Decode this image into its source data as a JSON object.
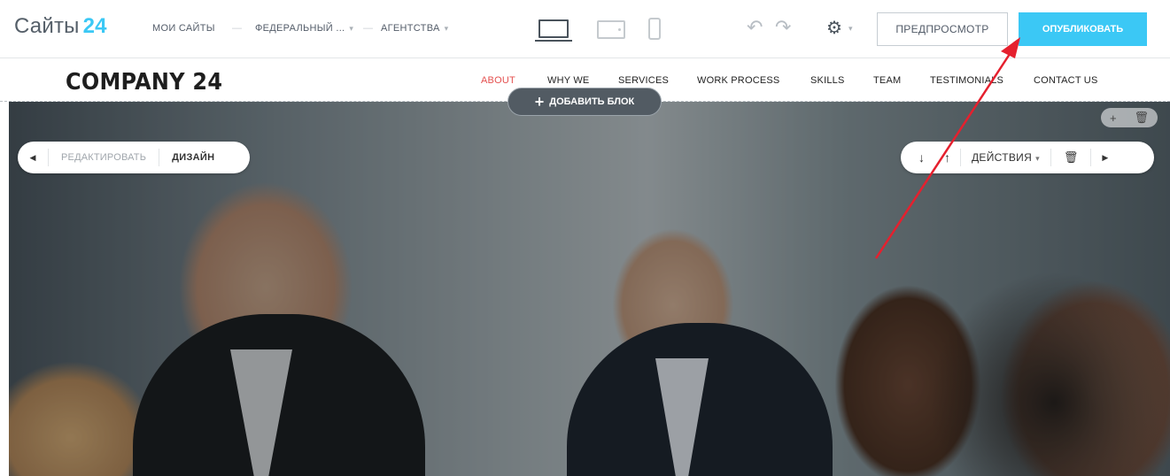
{
  "topbar": {
    "brand_name": "Сайты",
    "brand_number": "24",
    "nav": [
      {
        "label": "МОИ САЙТЫ"
      },
      {
        "label": "ФЕДЕРАЛЬНЫЙ ..."
      },
      {
        "label": "АГЕНТСТВА"
      }
    ],
    "undo_icon": "undo-icon",
    "redo_icon": "redo-icon",
    "settings_icon": "gear-icon",
    "preview_label": "ПРЕДПРОСМОТР",
    "publish_label": "ОПУБЛИКОВАТЬ",
    "accent_color": "#3bc8f5"
  },
  "site": {
    "logo": "COMPANY 24",
    "menu": [
      {
        "label": "ABOUT",
        "active": true
      },
      {
        "label": "WHY WE"
      },
      {
        "label": "SERVICES"
      },
      {
        "label": "WORK PROCESS"
      },
      {
        "label": "SKILLS"
      },
      {
        "label": "TEAM"
      },
      {
        "label": "TESTIMONIALS"
      },
      {
        "label": "CONTACT US"
      }
    ],
    "active_color": "#e4504f"
  },
  "editor": {
    "add_block_label": "ДОБАВИТЬ БЛОК",
    "edit_label": "РЕДАКТИРОВАТЬ",
    "design_label": "ДИЗАЙН",
    "actions_label": "ДЕЙСТВИЯ"
  },
  "annotation": {
    "arrow_color": "#e5202e"
  }
}
